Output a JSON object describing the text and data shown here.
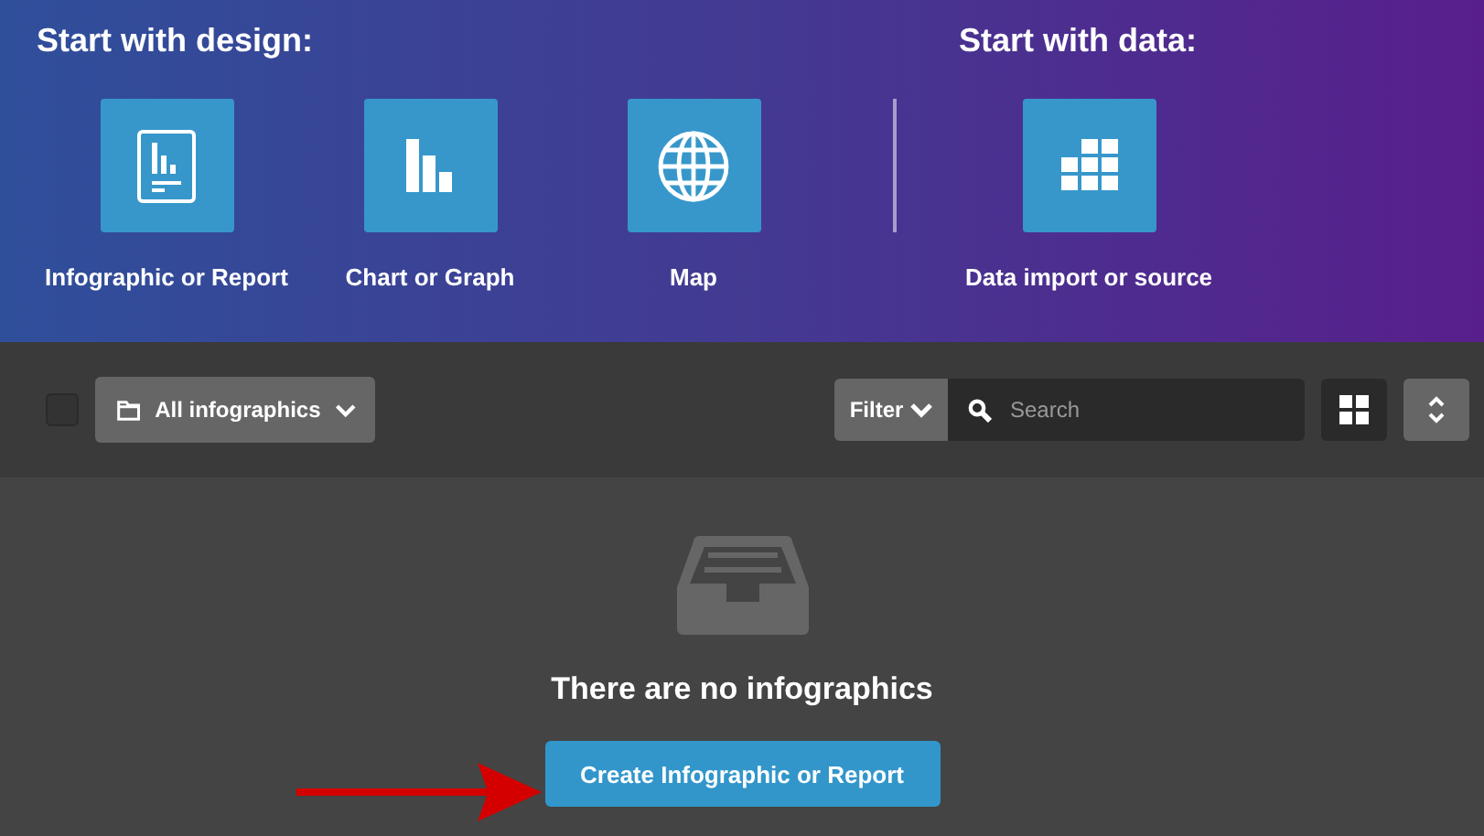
{
  "design": {
    "heading": "Start with design:",
    "tiles": [
      {
        "kind": "report",
        "label": "Infographic or Report"
      },
      {
        "kind": "chart",
        "label": "Chart or Graph"
      },
      {
        "kind": "map",
        "label": "Map"
      }
    ]
  },
  "data": {
    "heading": "Start with data:",
    "tiles": [
      {
        "kind": "grid",
        "label": "Data import or source"
      }
    ]
  },
  "toolbar": {
    "select_all": {
      "checked": false
    },
    "folder": "All infographics",
    "filter": "Filter",
    "search": {
      "placeholder": "Search"
    }
  },
  "empty": {
    "message": "There are no infographics",
    "button": "Create Infographic or Report"
  }
}
